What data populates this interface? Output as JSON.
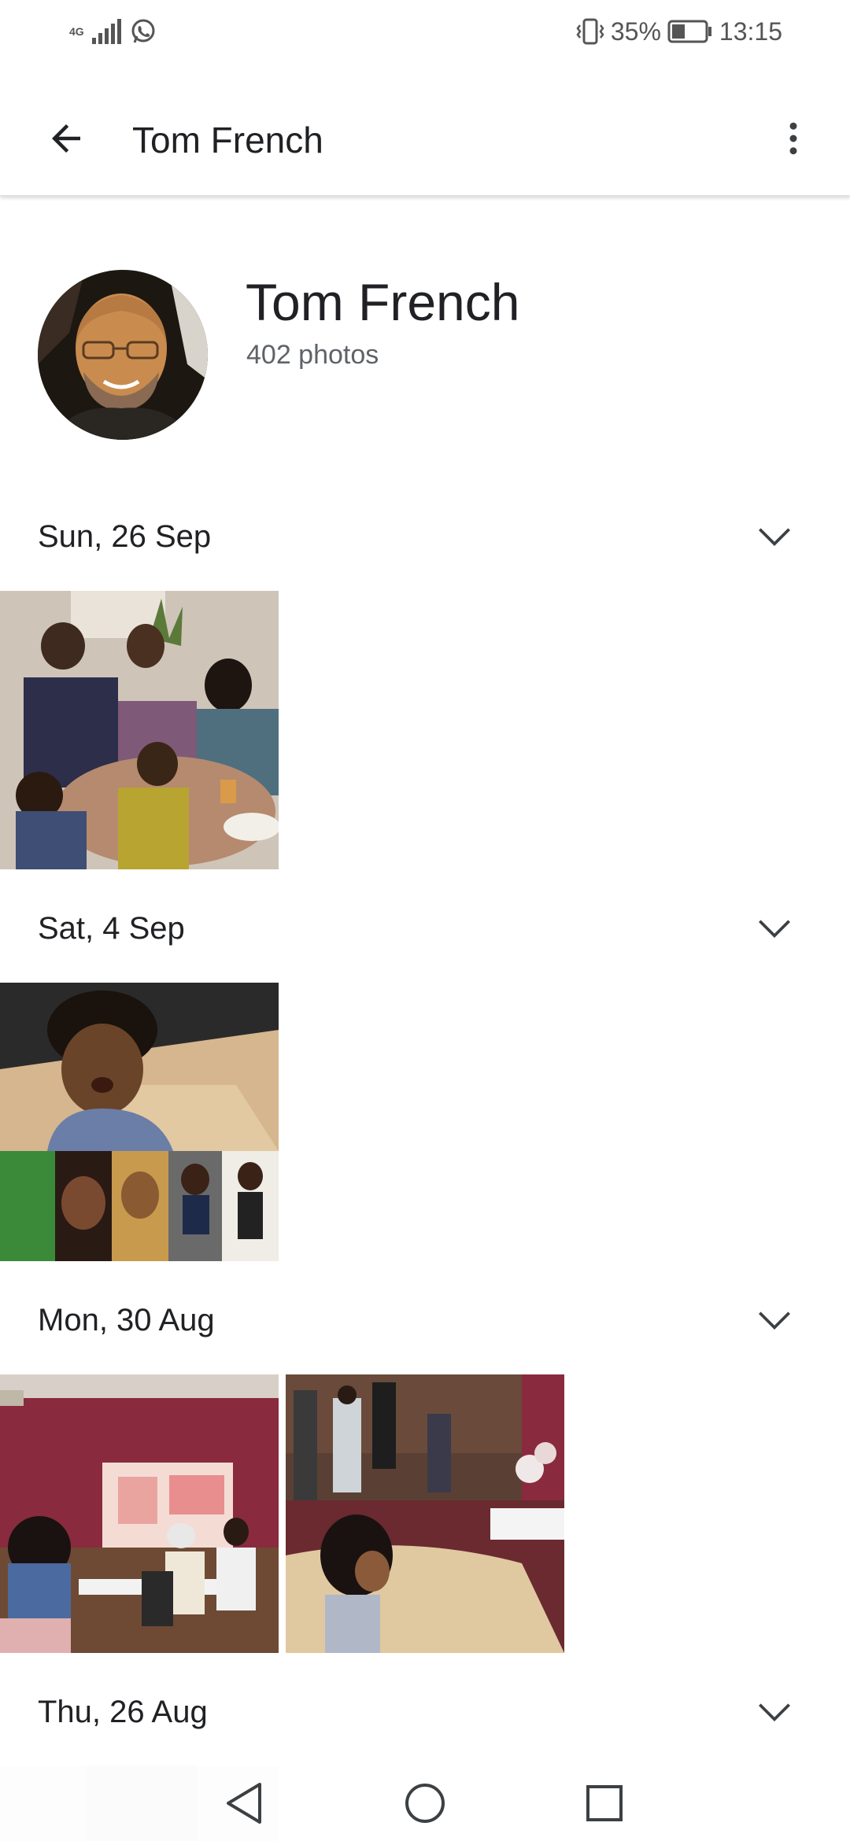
{
  "status_bar": {
    "network": "4G",
    "battery": "35%",
    "time": "13:15",
    "icons": [
      "signal-icon",
      "whatsapp-icon",
      "vibrate-icon",
      "battery-icon"
    ]
  },
  "app_bar": {
    "title": "Tom French",
    "icons": [
      "back-arrow-icon",
      "more-vert-icon"
    ]
  },
  "profile": {
    "name": "Tom French",
    "photo_count": "402 photos"
  },
  "sections": [
    {
      "date": "Sun, 26 Sep"
    },
    {
      "date": "Sat, 4 Sep"
    },
    {
      "date": "Mon, 30 Aug"
    },
    {
      "date": "Thu, 26 Aug"
    }
  ],
  "nav_bar": {
    "icons": [
      "back-triangle-icon",
      "home-circle-icon",
      "recents-square-icon"
    ]
  },
  "colors": {
    "text_primary": "#202124",
    "text_secondary": "#5f6368",
    "icon": "#3c4043"
  }
}
